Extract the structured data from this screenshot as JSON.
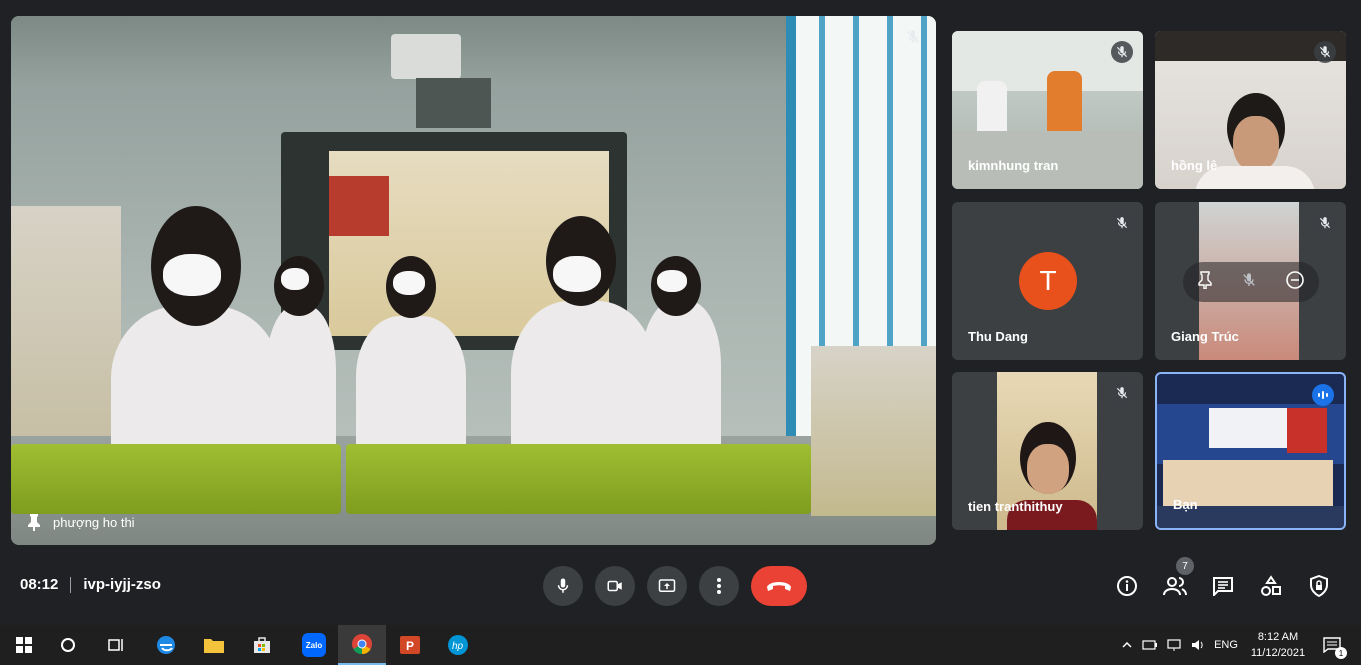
{
  "meeting": {
    "time": "08:12",
    "code": "ivp-iyjj-zso",
    "participant_count": "7"
  },
  "main_tile": {
    "name": "phượng ho thi"
  },
  "tiles": [
    {
      "name": "kimnhung tran"
    },
    {
      "name": "hồng lê"
    },
    {
      "name": "Thu Dang",
      "avatar_letter": "T"
    },
    {
      "name": "Giang Trúc"
    },
    {
      "name": "tien tranthithuy"
    },
    {
      "name": "Bạn"
    }
  ],
  "taskbar": {
    "apps": [
      "start",
      "search",
      "task-view",
      "edge",
      "file-explorer",
      "store",
      "zalo",
      "chrome",
      "powerpoint",
      "hp"
    ],
    "zalo_label": "Zalo",
    "language": "ENG",
    "time": "8:12 AM",
    "date": "11/12/2021",
    "notification_count": "1"
  },
  "colors": {
    "background": "#202124",
    "end_call": "#ea4335",
    "avatar": "#e8501c",
    "active_border": "#8ab4f8"
  }
}
